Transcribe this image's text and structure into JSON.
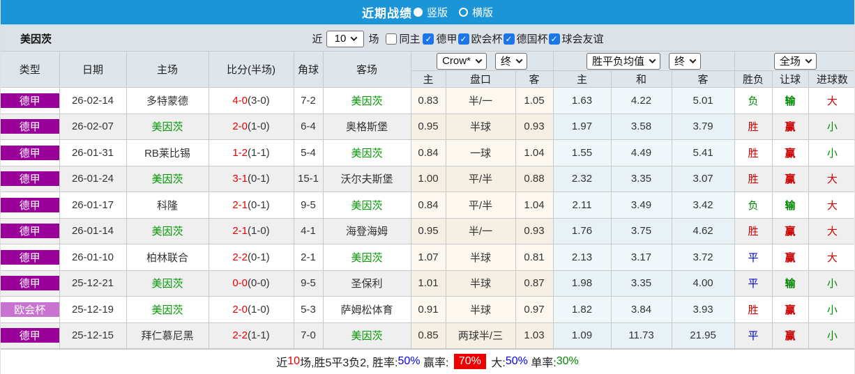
{
  "top_bar": {
    "title": "近期战绩",
    "radios": [
      {
        "label": "竖版",
        "selected": true
      },
      {
        "label": "横版",
        "selected": false
      }
    ]
  },
  "filter_bar": {
    "team": "美因茨",
    "recent_label": "近",
    "recent_value": "10",
    "games_label": "场",
    "same_home": {
      "label": "同主",
      "checked": false
    },
    "leagues": [
      {
        "label": "德甲",
        "checked": true
      },
      {
        "label": "欧会杯",
        "checked": true
      },
      {
        "label": "德国杯",
        "checked": true
      },
      {
        "label": "球会友谊",
        "checked": true
      }
    ]
  },
  "table": {
    "main_headers": [
      "类型",
      "日期",
      "主场",
      "比分(半场)",
      "角球",
      "客场"
    ],
    "sub_headers": [
      "主",
      "盘口",
      "客",
      "主",
      "和",
      "客",
      "胜负",
      "让球",
      "进球数"
    ],
    "dropdowns": {
      "company": "Crow*",
      "company_time": "终",
      "avg": "胜平负均值",
      "avg_time": "终",
      "scope": "全场"
    },
    "rows": [
      {
        "league": "德甲",
        "league_color": "dark",
        "date": "26-02-14",
        "home": "多特蒙德",
        "home_is_focus": false,
        "score": "4-0",
        "half": "(3-0)",
        "corner": "7-2",
        "away": "美因茨",
        "away_is_focus": true,
        "crow_home": "0.83",
        "handicap": "半/一",
        "crow_away": "1.05",
        "avg_win": "1.63",
        "avg_draw": "4.22",
        "avg_lose": "5.01",
        "result": "负",
        "result_color": "green",
        "handicap_result": "输",
        "handicap_result_color": "green",
        "goals": "大",
        "goals_color": "red"
      },
      {
        "league": "德甲",
        "league_color": "dark",
        "date": "26-02-07",
        "home": "美因茨",
        "home_is_focus": true,
        "score": "2-0",
        "half": "(1-0)",
        "corner": "6-4",
        "away": "奥格斯堡",
        "away_is_focus": false,
        "crow_home": "0.95",
        "handicap": "半球",
        "crow_away": "0.93",
        "avg_win": "1.97",
        "avg_draw": "3.58",
        "avg_lose": "3.79",
        "result": "胜",
        "result_color": "red",
        "handicap_result": "赢",
        "handicap_result_color": "red",
        "goals": "小",
        "goals_color": "green"
      },
      {
        "league": "德甲",
        "league_color": "dark",
        "date": "26-01-31",
        "home": "RB莱比锡",
        "home_is_focus": false,
        "score": "1-2",
        "half": "(1-1)",
        "corner": "5-4",
        "away": "美因茨",
        "away_is_focus": true,
        "crow_home": "0.84",
        "handicap": "一球",
        "crow_away": "1.04",
        "avg_win": "1.55",
        "avg_draw": "4.49",
        "avg_lose": "5.41",
        "result": "胜",
        "result_color": "red",
        "handicap_result": "赢",
        "handicap_result_color": "red",
        "goals": "小",
        "goals_color": "green"
      },
      {
        "league": "德甲",
        "league_color": "dark",
        "date": "26-01-24",
        "home": "美因茨",
        "home_is_focus": true,
        "score": "3-1",
        "half": "(0-1)",
        "corner": "15-1",
        "away": "沃尔夫斯堡",
        "away_is_focus": false,
        "crow_home": "1.00",
        "handicap": "平/半",
        "crow_away": "0.88",
        "avg_win": "2.32",
        "avg_draw": "3.35",
        "avg_lose": "3.07",
        "result": "胜",
        "result_color": "red",
        "handicap_result": "赢",
        "handicap_result_color": "red",
        "goals": "大",
        "goals_color": "red"
      },
      {
        "league": "德甲",
        "league_color": "dark",
        "date": "26-01-17",
        "home": "科隆",
        "home_is_focus": false,
        "score": "2-1",
        "half": "(0-1)",
        "corner": "9-5",
        "away": "美因茨",
        "away_is_focus": true,
        "crow_home": "0.84",
        "handicap": "平/半",
        "crow_away": "1.04",
        "avg_win": "2.11",
        "avg_draw": "3.49",
        "avg_lose": "3.42",
        "result": "负",
        "result_color": "green",
        "handicap_result": "输",
        "handicap_result_color": "green",
        "goals": "大",
        "goals_color": "red"
      },
      {
        "league": "德甲",
        "league_color": "dark",
        "date": "26-01-14",
        "home": "美因茨",
        "home_is_focus": true,
        "score": "2-1",
        "half": "(1-0)",
        "corner": "4-1",
        "away": "海登海姆",
        "away_is_focus": false,
        "crow_home": "0.95",
        "handicap": "半/一",
        "crow_away": "0.93",
        "avg_win": "1.76",
        "avg_draw": "3.75",
        "avg_lose": "4.62",
        "result": "胜",
        "result_color": "red",
        "handicap_result": "赢",
        "handicap_result_color": "red",
        "goals": "大",
        "goals_color": "red"
      },
      {
        "league": "德甲",
        "league_color": "dark",
        "date": "26-01-10",
        "home": "柏林联合",
        "home_is_focus": false,
        "score": "2-2",
        "half": "(0-1)",
        "corner": "2-1",
        "away": "美因茨",
        "away_is_focus": true,
        "crow_home": "1.07",
        "handicap": "半球",
        "crow_away": "0.81",
        "avg_win": "2.13",
        "avg_draw": "3.17",
        "avg_lose": "3.72",
        "result": "平",
        "result_color": "blue",
        "handicap_result": "赢",
        "handicap_result_color": "red",
        "goals": "大",
        "goals_color": "red"
      },
      {
        "league": "德甲",
        "league_color": "dark",
        "date": "25-12-21",
        "home": "美因茨",
        "home_is_focus": true,
        "score": "0-0",
        "half": "(0-0)",
        "corner": "9-5",
        "away": "圣保利",
        "away_is_focus": false,
        "crow_home": "1.01",
        "handicap": "半球",
        "crow_away": "0.87",
        "avg_win": "1.98",
        "avg_draw": "3.35",
        "avg_lose": "4.00",
        "result": "平",
        "result_color": "blue",
        "handicap_result": "输",
        "handicap_result_color": "green",
        "goals": "小",
        "goals_color": "green"
      },
      {
        "league": "欧会杯",
        "league_color": "light",
        "date": "25-12-19",
        "home": "美因茨",
        "home_is_focus": true,
        "score": "2-0",
        "half": "(1-0)",
        "corner": "5-3",
        "away": "萨姆松体育",
        "away_is_focus": false,
        "crow_home": "0.91",
        "handicap": "半球",
        "crow_away": "0.97",
        "avg_win": "1.82",
        "avg_draw": "3.84",
        "avg_lose": "3.93",
        "result": "胜",
        "result_color": "red",
        "handicap_result": "赢",
        "handicap_result_color": "red",
        "goals": "小",
        "goals_color": "green"
      },
      {
        "league": "德甲",
        "league_color": "dark",
        "date": "25-12-15",
        "home": "拜仁慕尼黑",
        "home_is_focus": false,
        "score": "2-2",
        "half": "(1-1)",
        "corner": "7-0",
        "away": "美因茨",
        "away_is_focus": true,
        "crow_home": "0.85",
        "handicap": "两球半/三",
        "crow_away": "1.03",
        "avg_win": "1.09",
        "avg_draw": "11.73",
        "avg_lose": "21.95",
        "result": "平",
        "result_color": "blue",
        "handicap_result": "赢",
        "handicap_result_color": "red",
        "goals": "小",
        "goals_color": "green"
      }
    ]
  },
  "summary": {
    "segments": [
      {
        "text": "近",
        "color": "#222"
      },
      {
        "text": "10",
        "color": "#e60000"
      },
      {
        "text": "场,胜5平3负2, 胜率:",
        "color": "#222"
      },
      {
        "text": "50%",
        "color": "#0000ee"
      },
      {
        "text": " 赢率: ",
        "color": "#222"
      },
      {
        "text": "70%",
        "color": "#ffffff",
        "bg": "#ee0000"
      },
      {
        "text": " 大:",
        "color": "#222"
      },
      {
        "text": "50%",
        "color": "#0000ee"
      },
      {
        "text": " 单率:",
        "color": "#222"
      },
      {
        "text": "30%",
        "color": "#008800"
      }
    ]
  },
  "colors": {
    "league_dark": "#990099",
    "league_light": "#c873d2",
    "topbar_blue": "#1b95d8"
  }
}
